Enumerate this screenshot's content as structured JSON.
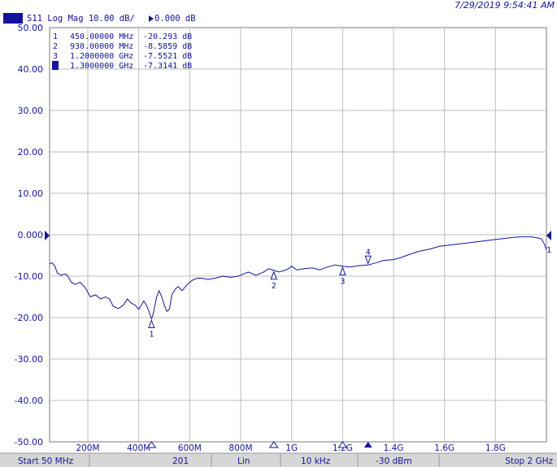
{
  "header": {
    "timestamp": "7/29/2019 9:54:41 AM",
    "trace_badge": "Tr1",
    "trace_label": "S11  Log Mag 10.00 dB/",
    "ref_value": "0.000 dB"
  },
  "status_bar": {
    "start": "Start 50 MHz",
    "points": "201",
    "sweep_type": "Lin",
    "ifbw": "10 kHz",
    "power": "-30 dBm",
    "stop": "Stop 2 GHz"
  },
  "markers": [
    {
      "num": "1",
      "freq": "450.00000 MHz",
      "value": "-20.293 dB",
      "active": false
    },
    {
      "num": "2",
      "freq": "930.00000 MHz",
      "value": "-8.5859 dB",
      "active": false
    },
    {
      "num": "3",
      "freq": "1.2000000 GHz",
      "value": "-7.5521 dB",
      "active": false
    },
    {
      "num": "4",
      "freq": "1.3000000 GHz",
      "value": "-7.3141 dB",
      "active": true
    }
  ],
  "colors": {
    "trace": "#14149a",
    "grid": "#bdbdbd",
    "status_bg": "#d6d6d6"
  },
  "chart_data": {
    "type": "line",
    "xlabel": "",
    "ylabel": "",
    "xlim_mhz": [
      50,
      2000
    ],
    "ylim": [
      -50,
      50
    ],
    "grid": true,
    "y_tick_labels": [
      "50.00",
      "40.00",
      "30.00",
      "20.00",
      "10.00",
      "0.000",
      "-10.00",
      "-20.00",
      "-30.00",
      "-40.00",
      "-50.00"
    ],
    "y_tick_values": [
      50,
      40,
      30,
      20,
      10,
      0,
      -10,
      -20,
      -30,
      -40,
      -50
    ],
    "x_tick_labels": [
      "200M",
      "400M",
      "600M",
      "800M",
      "1G",
      "1.2G",
      "1.4G",
      "1.6G",
      "1.8G"
    ],
    "x_tick_values": [
      200,
      400,
      600,
      800,
      1000,
      1200,
      1400,
      1600,
      1800
    ],
    "series": [
      {
        "x": [
          50,
          60,
          70,
          80,
          95,
          110,
          120,
          135,
          150,
          170,
          190,
          210,
          230,
          250,
          270,
          285,
          300,
          320,
          340,
          355,
          370,
          385,
          400,
          410,
          420,
          430,
          440,
          450,
          455,
          460,
          470,
          480,
          490,
          500,
          510,
          520,
          530,
          545,
          555,
          570,
          590,
          610,
          630,
          650,
          670,
          700,
          730,
          760,
          790,
          810,
          830,
          860,
          890,
          910,
          930,
          950,
          980,
          1000,
          1020,
          1050,
          1080,
          1110,
          1140,
          1170,
          1200,
          1230,
          1260,
          1300,
          1330,
          1360,
          1400,
          1430,
          1460,
          1500,
          1540,
          1580,
          1620,
          1660,
          1700,
          1740,
          1780,
          1820,
          1860,
          1900,
          1940,
          1960,
          1980,
          1990,
          2000
        ],
        "values": [
          -7,
          -6.8,
          -7.5,
          -9.2,
          -9.8,
          -9.5,
          -9.8,
          -11.5,
          -12.0,
          -11.5,
          -12.8,
          -15.0,
          -14.5,
          -15.5,
          -15.0,
          -15.5,
          -17.3,
          -17.8,
          -17.0,
          -15.5,
          -16.5,
          -17.0,
          -18.0,
          -17.0,
          -16.0,
          -17.0,
          -18.5,
          -20.3,
          -19.5,
          -18.0,
          -15.0,
          -13.5,
          -15.0,
          -17.0,
          -18.5,
          -18.0,
          -14.5,
          -13.0,
          -12.5,
          -13.5,
          -12.0,
          -11.0,
          -10.5,
          -10.5,
          -10.8,
          -10.5,
          -10.0,
          -10.3,
          -10.0,
          -9.5,
          -9.0,
          -9.8,
          -9.0,
          -8.2,
          -8.6,
          -9.0,
          -8.5,
          -7.6,
          -8.5,
          -8.2,
          -8.0,
          -8.5,
          -7.8,
          -7.3,
          -7.6,
          -7.8,
          -7.5,
          -7.3,
          -6.8,
          -6.2,
          -6.0,
          -5.5,
          -4.8,
          -4.0,
          -3.5,
          -2.8,
          -2.5,
          -2.2,
          -1.9,
          -1.6,
          -1.3,
          -1.0,
          -0.7,
          -0.5,
          -0.5,
          -0.7,
          -1.0,
          -2.0,
          -3.6
        ]
      }
    ],
    "markers": [
      {
        "label": "1",
        "x": 450,
        "y": -20.293
      },
      {
        "label": "2",
        "x": 930,
        "y": -8.5859
      },
      {
        "label": "3",
        "x": 1200,
        "y": -7.5521
      },
      {
        "label": "4",
        "x": 1300,
        "y": -7.3141
      }
    ],
    "ref_level": 0,
    "ref_label": "1"
  }
}
